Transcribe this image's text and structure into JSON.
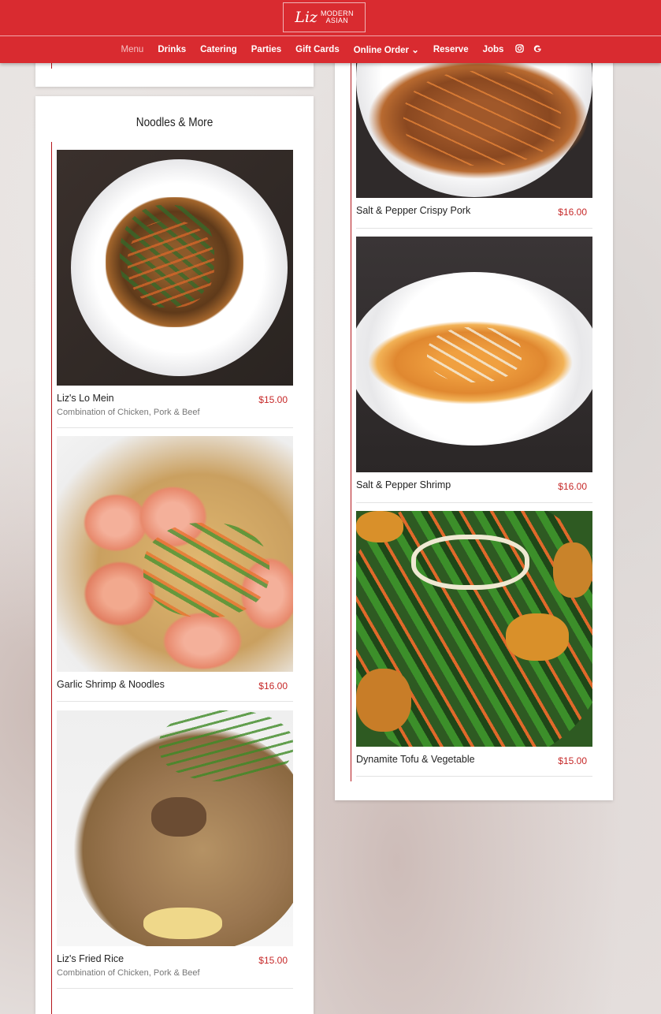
{
  "logo": {
    "script": "Liz",
    "line1": "MODERN",
    "line2": "ASIAN"
  },
  "nav": {
    "items": [
      {
        "label": "Menu",
        "active": true
      },
      {
        "label": "Drinks"
      },
      {
        "label": "Catering"
      },
      {
        "label": "Parties"
      },
      {
        "label": "Gift Cards"
      },
      {
        "label": "Online Order ⌄"
      },
      {
        "label": "Reserve"
      },
      {
        "label": "Jobs"
      }
    ],
    "icons": [
      "instagram-icon",
      "google-icon"
    ]
  },
  "section": {
    "title": "Noodles & More"
  },
  "left_items": [
    {
      "name": "Liz's Lo Mein",
      "price": "$15.00",
      "desc": "Combination of Chicken, Pork & Beef"
    },
    {
      "name": "Garlic Shrimp & Noodles",
      "price": "$16.00",
      "desc": ""
    },
    {
      "name": "Liz's Fried Rice",
      "price": "$15.00",
      "desc": "Combination of Chicken, Pork & Beef"
    }
  ],
  "right_items": [
    {
      "name": "Salt & Pepper Crispy Pork",
      "price": "$16.00"
    },
    {
      "name": "Salt & Pepper Shrimp",
      "price": "$16.00"
    },
    {
      "name": "Dynamite Tofu & Vegetable",
      "price": "$15.00"
    }
  ],
  "colors": {
    "brand": "#d92b30",
    "price": "#c62828"
  }
}
